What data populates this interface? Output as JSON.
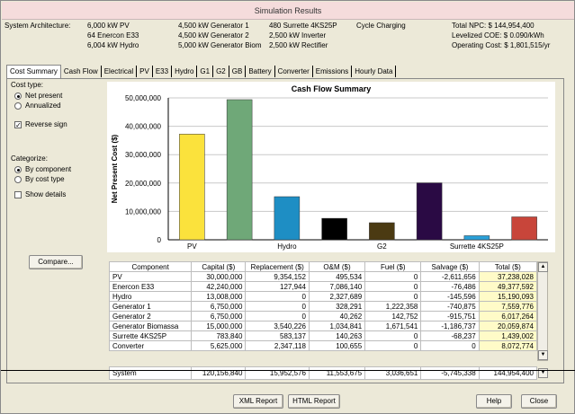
{
  "window": {
    "title": "Simulation Results"
  },
  "architecture": {
    "label": "System Architecture:",
    "col1": [
      "6,000 kW PV",
      "64 Enercon E33",
      "6,004 kW Hydro"
    ],
    "col2": [
      "4,500 kW Generator 1",
      "4,500 kW Generator 2",
      "5,000 kW Generator Biom"
    ],
    "col3": [
      "480 Surrette 4KS25P",
      "2,500 kW Inverter",
      "2,500 kW Rectifier"
    ],
    "col4": [
      "Cycle Charging",
      "",
      ""
    ],
    "col5": [
      "Total NPC:  $ 144,954,400",
      "Levelized COE:  $ 0.090/kWh",
      "Operating Cost:  $ 1,801,515/yr"
    ]
  },
  "tabs": [
    "Cost Summary",
    "Cash Flow",
    "Electrical",
    "PV",
    "E33",
    "Hydro",
    "G1",
    "G2",
    "GB",
    "Battery",
    "Converter",
    "Emissions",
    "Hourly Data"
  ],
  "active_tab": "Cost Summary",
  "options": {
    "cost_type_label": "Cost type:",
    "net_present": "Net present",
    "annualized": "Annualized",
    "reverse_sign": "Reverse sign",
    "categorize_label": "Categorize:",
    "by_component": "By component",
    "by_cost_type": "By cost type",
    "show_details": "Show details",
    "compare": "Compare..."
  },
  "chart_data": {
    "type": "bar",
    "title": "Cash Flow Summary",
    "ylabel": "Net Present Cost ($)",
    "ylim": [
      0,
      50000000
    ],
    "yticks": [
      "0",
      "10,000,000",
      "20,000,000",
      "30,000,000",
      "40,000,000",
      "50,000,000"
    ],
    "categories": [
      "PV",
      "Enercon E33",
      "Hydro",
      "Generator 1",
      "Generator 2",
      "Generator Biomassa",
      "Surrette 4KS25P",
      "Converter"
    ],
    "xtick_labels": [
      "PV",
      "",
      "Hydro",
      "",
      "G2",
      "",
      "Surrette 4KS25P",
      ""
    ],
    "values": [
      37238028,
      49377592,
      15190093,
      7559776,
      6017264,
      20059874,
      1439002,
      8072774
    ],
    "colors": [
      "#fbe23c",
      "#6fa878",
      "#1e8ec4",
      "#000000",
      "#4b3a12",
      "#2a0a44",
      "#2aa0d8",
      "#c8453a"
    ],
    "grid": true,
    "legend": "none"
  },
  "table": {
    "headers": [
      "Component",
      "Capital ($)",
      "Replacement ($)",
      "O&M ($)",
      "Fuel ($)",
      "Salvage ($)",
      "Total ($)"
    ],
    "rows": [
      [
        "PV",
        "30,000,000",
        "9,354,152",
        "495,534",
        "0",
        "-2,611,656",
        "37,238,028"
      ],
      [
        "Enercon E33",
        "42,240,000",
        "127,944",
        "7,086,140",
        "0",
        "-76,486",
        "49,377,592"
      ],
      [
        "Hydro",
        "13,008,000",
        "0",
        "2,327,689",
        "0",
        "-145,596",
        "15,190,093"
      ],
      [
        "Generator 1",
        "6,750,000",
        "0",
        "328,291",
        "1,222,358",
        "-740,875",
        "7,559,776"
      ],
      [
        "Generator 2",
        "6,750,000",
        "0",
        "40,262",
        "142,752",
        "-915,751",
        "6,017,264"
      ],
      [
        "Generator Biomassa",
        "15,000,000",
        "3,540,226",
        "1,034,841",
        "1,671,541",
        "-1,186,737",
        "20,059,874"
      ],
      [
        "Surrette 4KS25P",
        "783,840",
        "583,137",
        "140,263",
        "0",
        "-68,237",
        "1,439,002"
      ],
      [
        "Converter",
        "5,625,000",
        "2,347,118",
        "100,655",
        "0",
        "0",
        "8,072,774"
      ]
    ],
    "system": [
      "System",
      "120,156,840",
      "15,952,576",
      "11,553,675",
      "3,036,651",
      "-5,745,338",
      "144,954,400"
    ]
  },
  "footer": {
    "xml_report": "XML Report",
    "html_report": "HTML Report",
    "help": "Help",
    "close": "Close"
  }
}
